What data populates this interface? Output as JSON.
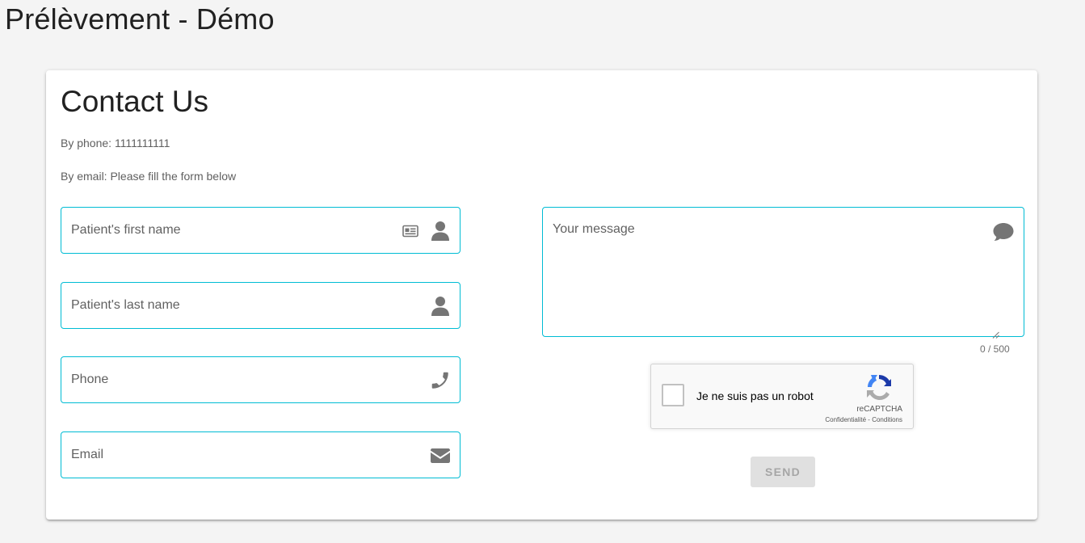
{
  "app": {
    "title": "Prélèvement - Démo"
  },
  "contact": {
    "heading": "Contact Us",
    "phone_line": "By phone: 1111111111",
    "email_line": "By email: Please fill the form below"
  },
  "form": {
    "first_name": {
      "value": "",
      "placeholder": "Patient's first name",
      "icons": [
        "id-card-icon",
        "person-icon"
      ]
    },
    "last_name": {
      "value": "",
      "placeholder": "Patient's last name",
      "icons": [
        "person-icon"
      ]
    },
    "phone": {
      "value": "",
      "placeholder": "Phone",
      "icons": [
        "phone-icon"
      ]
    },
    "email": {
      "value": "",
      "placeholder": "Email",
      "icons": [
        "envelope-icon"
      ]
    },
    "message": {
      "value": "",
      "placeholder": "Your message",
      "icons": [
        "speech-bubble-icon"
      ],
      "counter": "0 / 500"
    }
  },
  "captcha": {
    "label": "Je ne suis pas un robot",
    "brand": "reCAPTCHA",
    "privacy": "Confidentialité",
    "separator": "-",
    "terms": "Conditions",
    "checked": false
  },
  "actions": {
    "send_label": "SEND",
    "send_disabled": true
  },
  "colors": {
    "accent": "#00bcd4",
    "icon": "#757575",
    "background": "#f4f4f4",
    "button_disabled_bg": "#e0e0e0"
  }
}
